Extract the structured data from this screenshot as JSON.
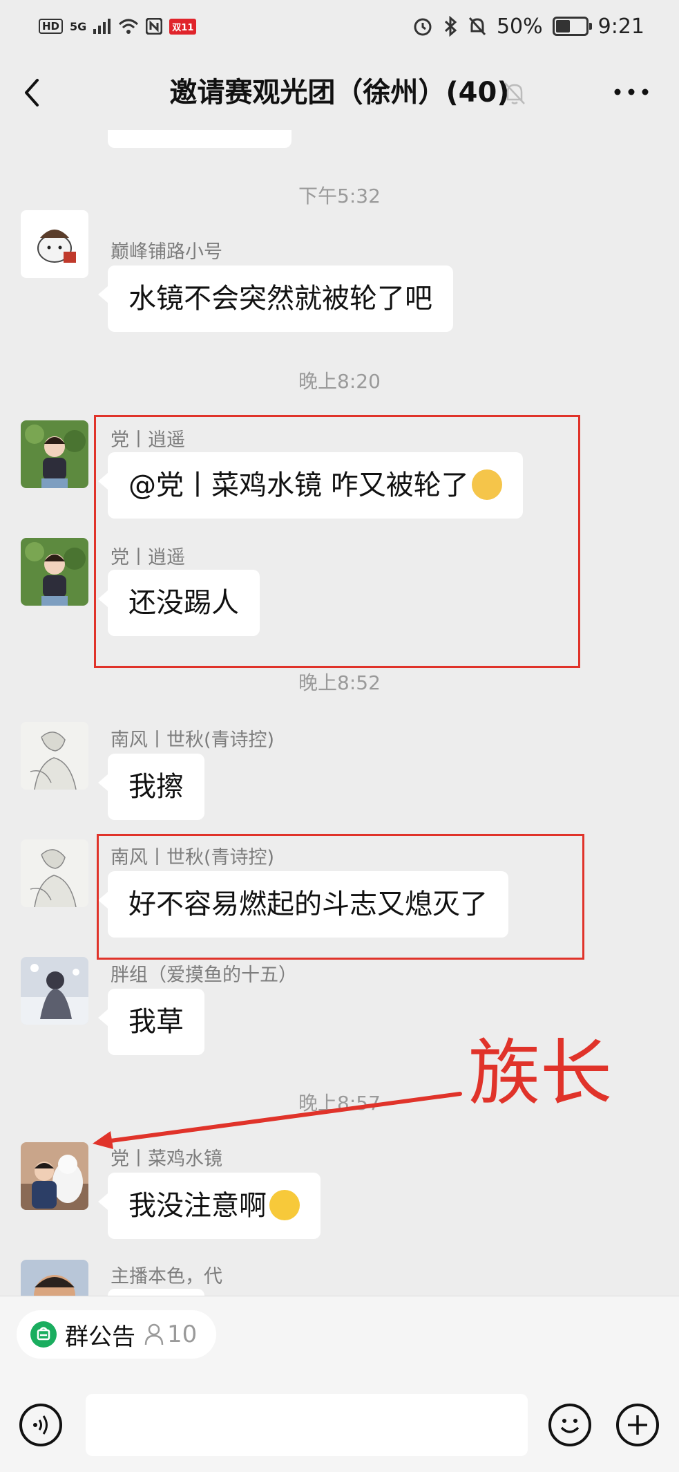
{
  "status_bar": {
    "network": "HD",
    "signal": "5G",
    "badge": "双11",
    "battery": "50%",
    "battery_level": 0.5,
    "time": "9:21"
  },
  "header": {
    "title": "邀请赛观光团（徐州）(40)"
  },
  "messages": [
    {
      "type": "time",
      "text": "下午5:32"
    },
    {
      "type": "msg",
      "sender": "巅峰铺路小号",
      "text": "水镜不会突然就被轮了吧"
    },
    {
      "type": "time",
      "text": "晚上8:20"
    },
    {
      "type": "msg",
      "sender": "党丨逍遥",
      "text": "@党丨菜鸡水镜  咋又被轮了",
      "emoji": "doge-emoji"
    },
    {
      "type": "msg",
      "sender": "党丨逍遥",
      "text": "还没踢人"
    },
    {
      "type": "time",
      "text": "晚上8:52"
    },
    {
      "type": "msg",
      "sender": "南风丨世秋(青诗控)",
      "text": "我擦"
    },
    {
      "type": "msg",
      "sender": "南风丨世秋(青诗控)",
      "text": "好不容易燃起的斗志又熄灭了"
    },
    {
      "type": "msg",
      "sender": "胖组（爱摸鱼的十五）",
      "text": "我草"
    },
    {
      "type": "time",
      "text": "晚上8:57"
    },
    {
      "type": "msg",
      "sender": "党丨菜鸡水镜",
      "text": "我没注意啊",
      "emoji": "crying-laughing-emoji"
    },
    {
      "type": "msg",
      "sender": "主播本色，代",
      "text": ""
    }
  ],
  "annotation": {
    "text": "族长",
    "color": "#e0332a"
  },
  "notice": {
    "label": "群公告",
    "count": "10"
  },
  "colors": {
    "background": "#ededed",
    "bubble": "#ffffff",
    "highlight": "#e0332a",
    "notice_icon": "#1aad5f"
  }
}
